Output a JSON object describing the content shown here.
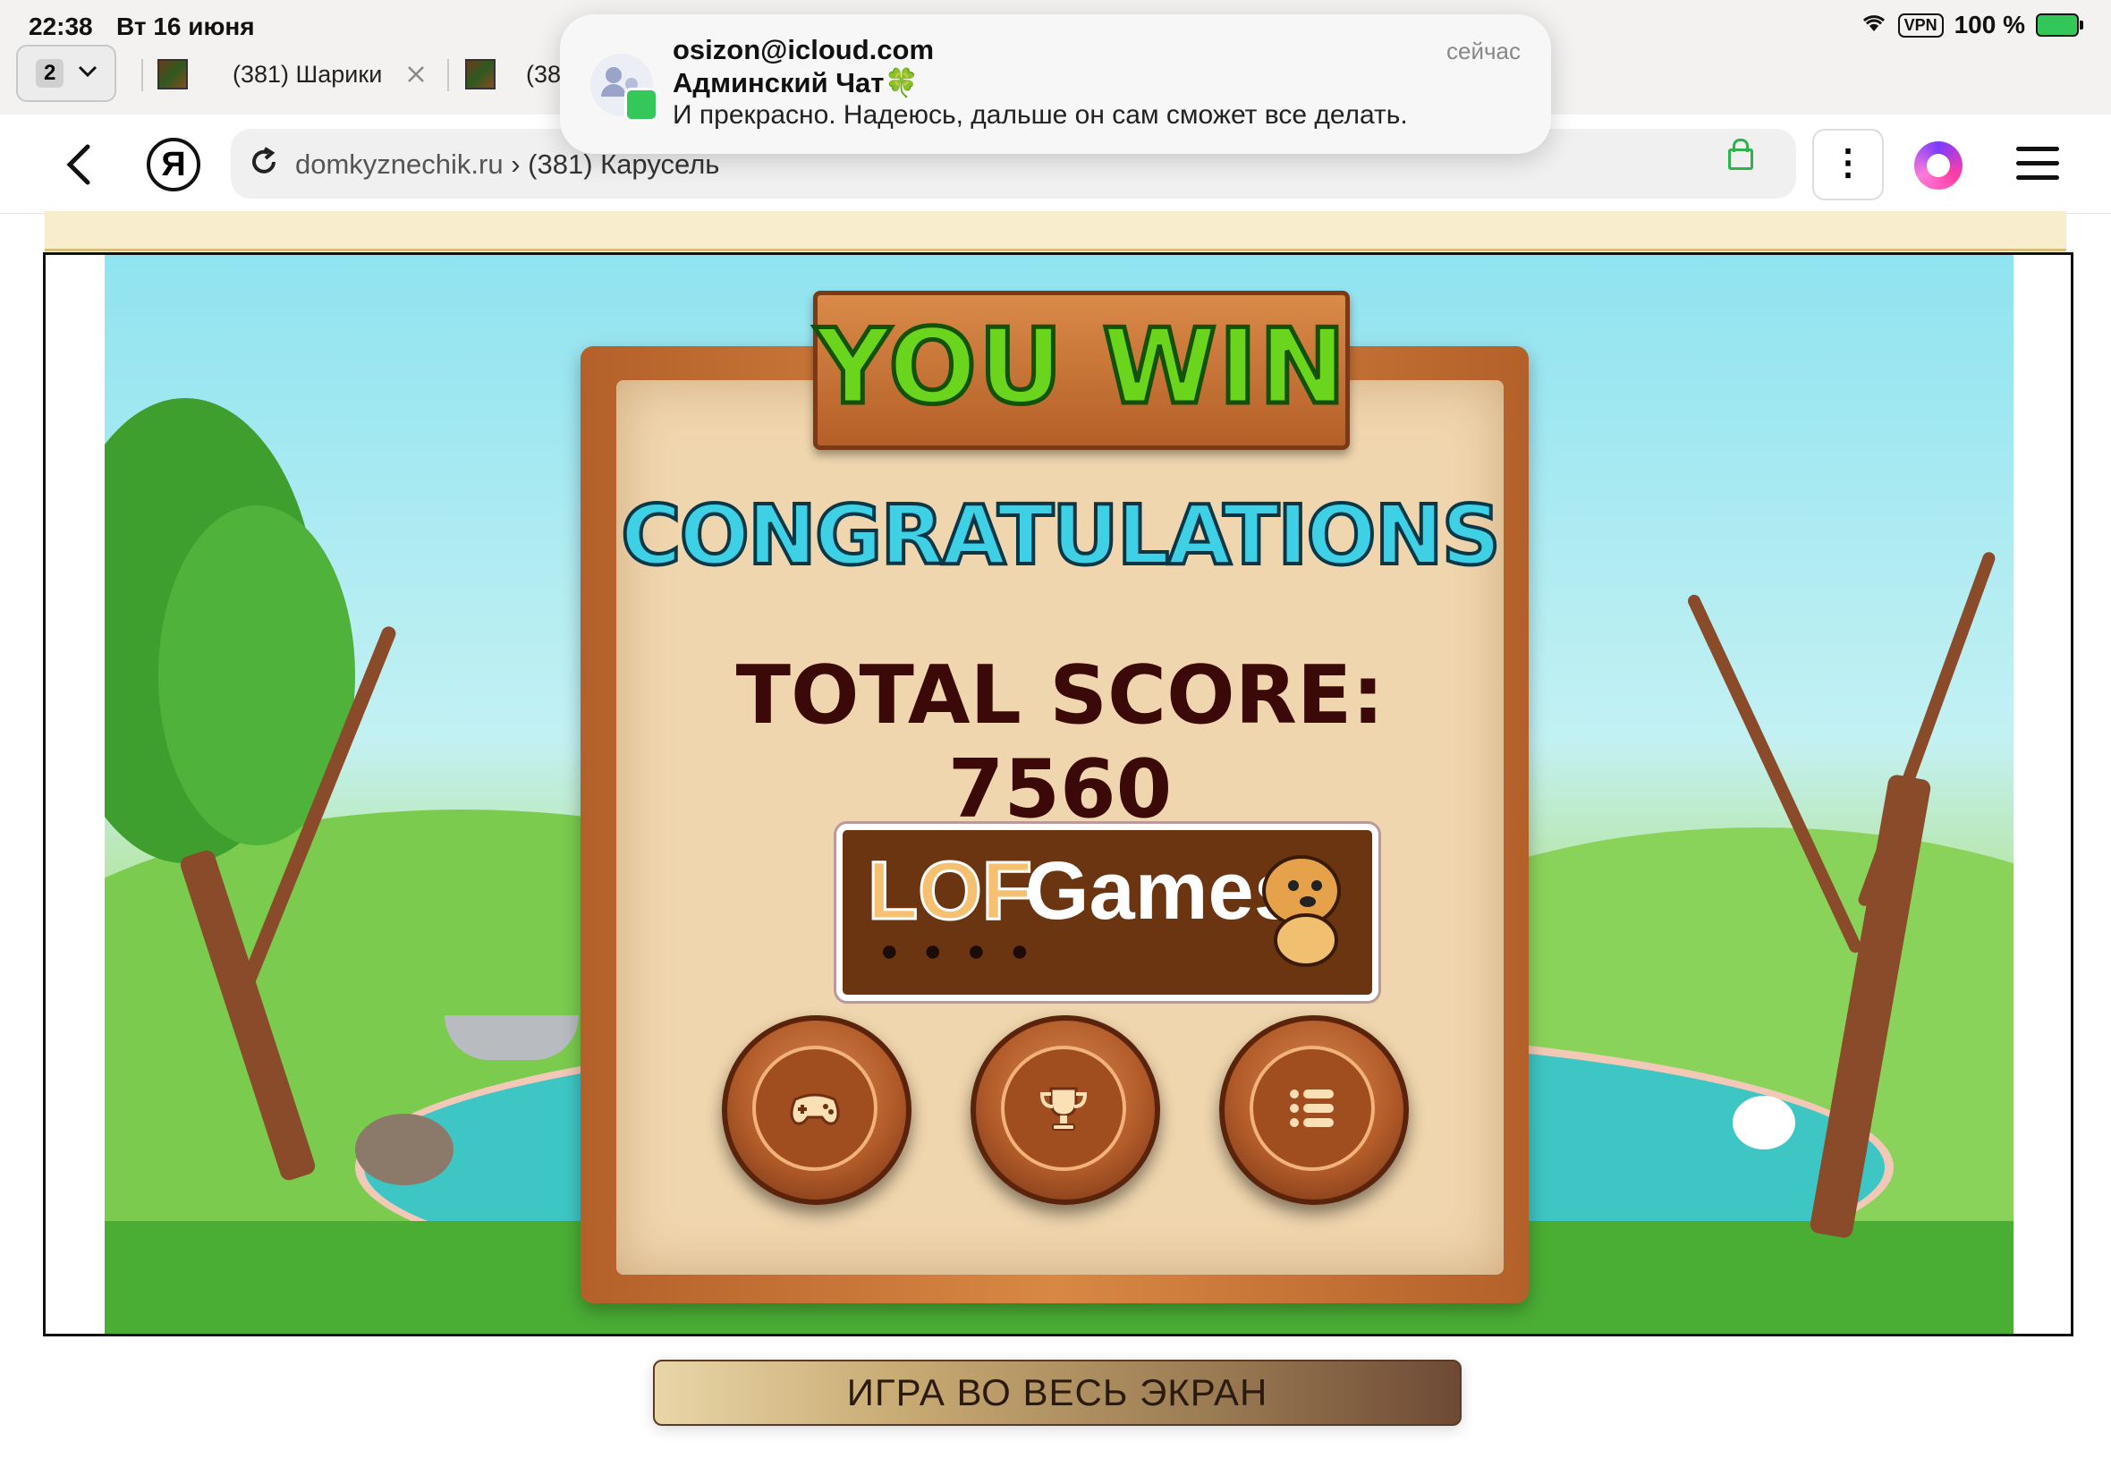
{
  "status_bar": {
    "time": "22:38",
    "date": "Вт 16 июня",
    "vpn": "VPN",
    "battery": "100 %"
  },
  "tabs": {
    "count": "2",
    "items": [
      {
        "label": "(381) Шарики"
      },
      {
        "label": "(38"
      }
    ]
  },
  "address_bar": {
    "domain": "domkyznechik.ru",
    "separator": " › ",
    "page": "(381) Карусель"
  },
  "notification": {
    "from": "osizon@icloud.com",
    "chat": "Админский Чат🍀",
    "text": "И прекрасно. Надеюсь, дальше он сам сможет все делать.",
    "time": "сейчас"
  },
  "game": {
    "banner": "YOU WIN",
    "congrats": "CONGRATULATIONS",
    "score_label": "TOTAL SCORE:",
    "score_value": "7560",
    "logo_lof": "LOF",
    "logo_games": "Games",
    "buttons": [
      {
        "icon": "gamepad-icon"
      },
      {
        "icon": "trophy-icon"
      },
      {
        "icon": "list-icon"
      }
    ]
  },
  "fullscreen_button": "ИГРА ВО ВЕСЬ ЭКРАН",
  "colors": {
    "you_win": "#6bd41c",
    "congrats": "#3ed0e4",
    "score": "#3b0a08",
    "wood": "#b55f28",
    "parchment": "#f0d6ae"
  }
}
